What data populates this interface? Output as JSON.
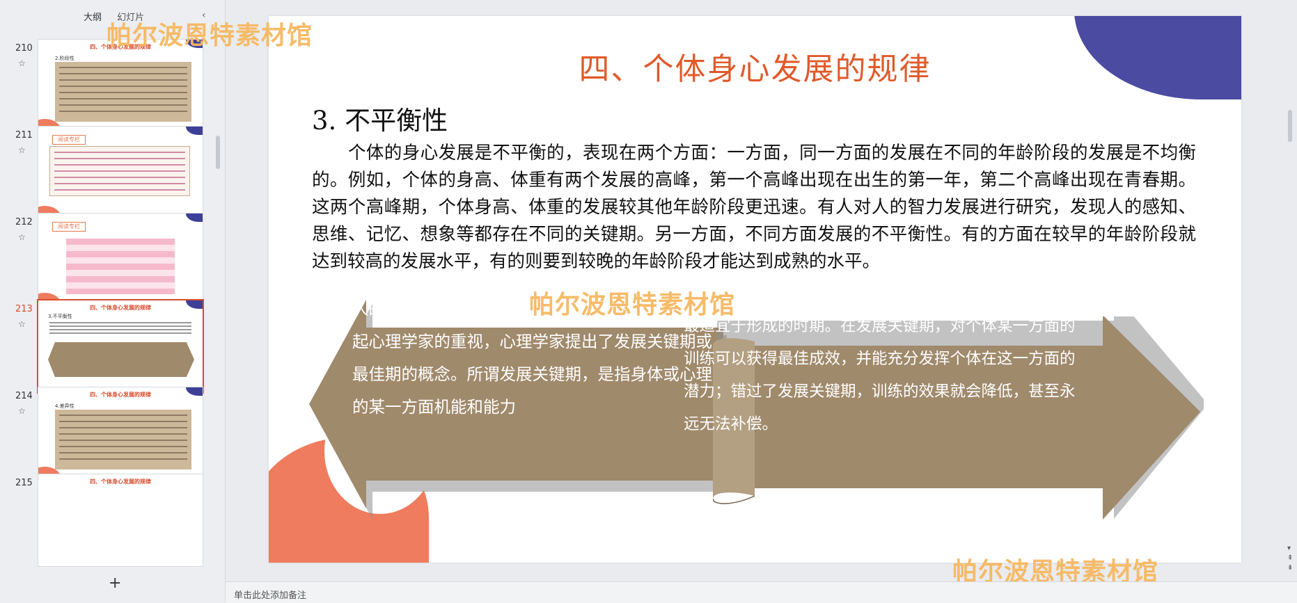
{
  "left_panel": {
    "tabs": [
      "大纲",
      "幻灯片"
    ],
    "collapse_icon": "‹",
    "add_icon": "+",
    "thumbnails": [
      {
        "number": "210",
        "title": "四、个体身心发展的规律",
        "sub": "2.阶段性",
        "style": "text"
      },
      {
        "number": "211",
        "title": "",
        "sub": "",
        "badge": "阅读专栏",
        "style": "light"
      },
      {
        "number": "212",
        "title": "",
        "sub": "",
        "badge": "阅读专栏",
        "style": "table"
      },
      {
        "number": "213",
        "title": "四、个体身心发展的规律",
        "sub": "3.不平衡性",
        "style": "arrows",
        "active": true
      },
      {
        "number": "214",
        "title": "四、个体身心发展的规律",
        "sub": "4.差异性",
        "style": "text"
      },
      {
        "number": "215",
        "title": "四、个体身心发展的规律",
        "sub": "",
        "style": "text"
      }
    ]
  },
  "slide": {
    "title": "四、个体身心发展的规律",
    "section_heading": "3. 不平衡性",
    "body": "个体的身心发展是不平衡的，表现在两个方面：一方面，同一方面的发展在不同的年龄阶段的发展是不均衡的。例如，个体的身高、体重有两个发展的高峰，第一个高峰出现在出生的第一年，第二个高峰出现在青春期。这两个高峰期，个体身高、体重的发展较其他年龄阶段更迅速。有人对人的智力发展进行研究，发现人的感知、思维、记忆、想象等都存在不同的关键期。另一方面，不同方面发展的不平衡性。有的方面在较早的年龄阶段就达到较高的发展水平，有的则要到较晚的年龄阶段才能达到成熟的水平。",
    "arrow_left_text": "人的身心不同方面有不同的发展期现象，越来越引起心理学家的重视，心理学家提出了发展关键期或最佳期的概念。所谓发展关键期，是指身体或心理的某一方面机能和能力",
    "arrow_right_text": "最适宜于形成的时期。在发展关键期，对个体某一方面的训练可以获得最佳成效，并能充分发挥个体在这一方面的潜力；错过了发展关键期，训练的效果就会降低，甚至永远无法补偿。"
  },
  "watermarks": [
    "帕尔波恩特素材馆",
    "帕尔波恩特素材馆",
    "帕尔波恩特素材馆"
  ],
  "notes": {
    "placeholder": "单击此处添加备注"
  },
  "colors": {
    "accent_red": "#e05a2a",
    "arrow_brown": "#a08a6c",
    "blob_blue": "#4b4ba2",
    "blob_orange": "#ef7c5e",
    "watermark": "#f7b860"
  }
}
